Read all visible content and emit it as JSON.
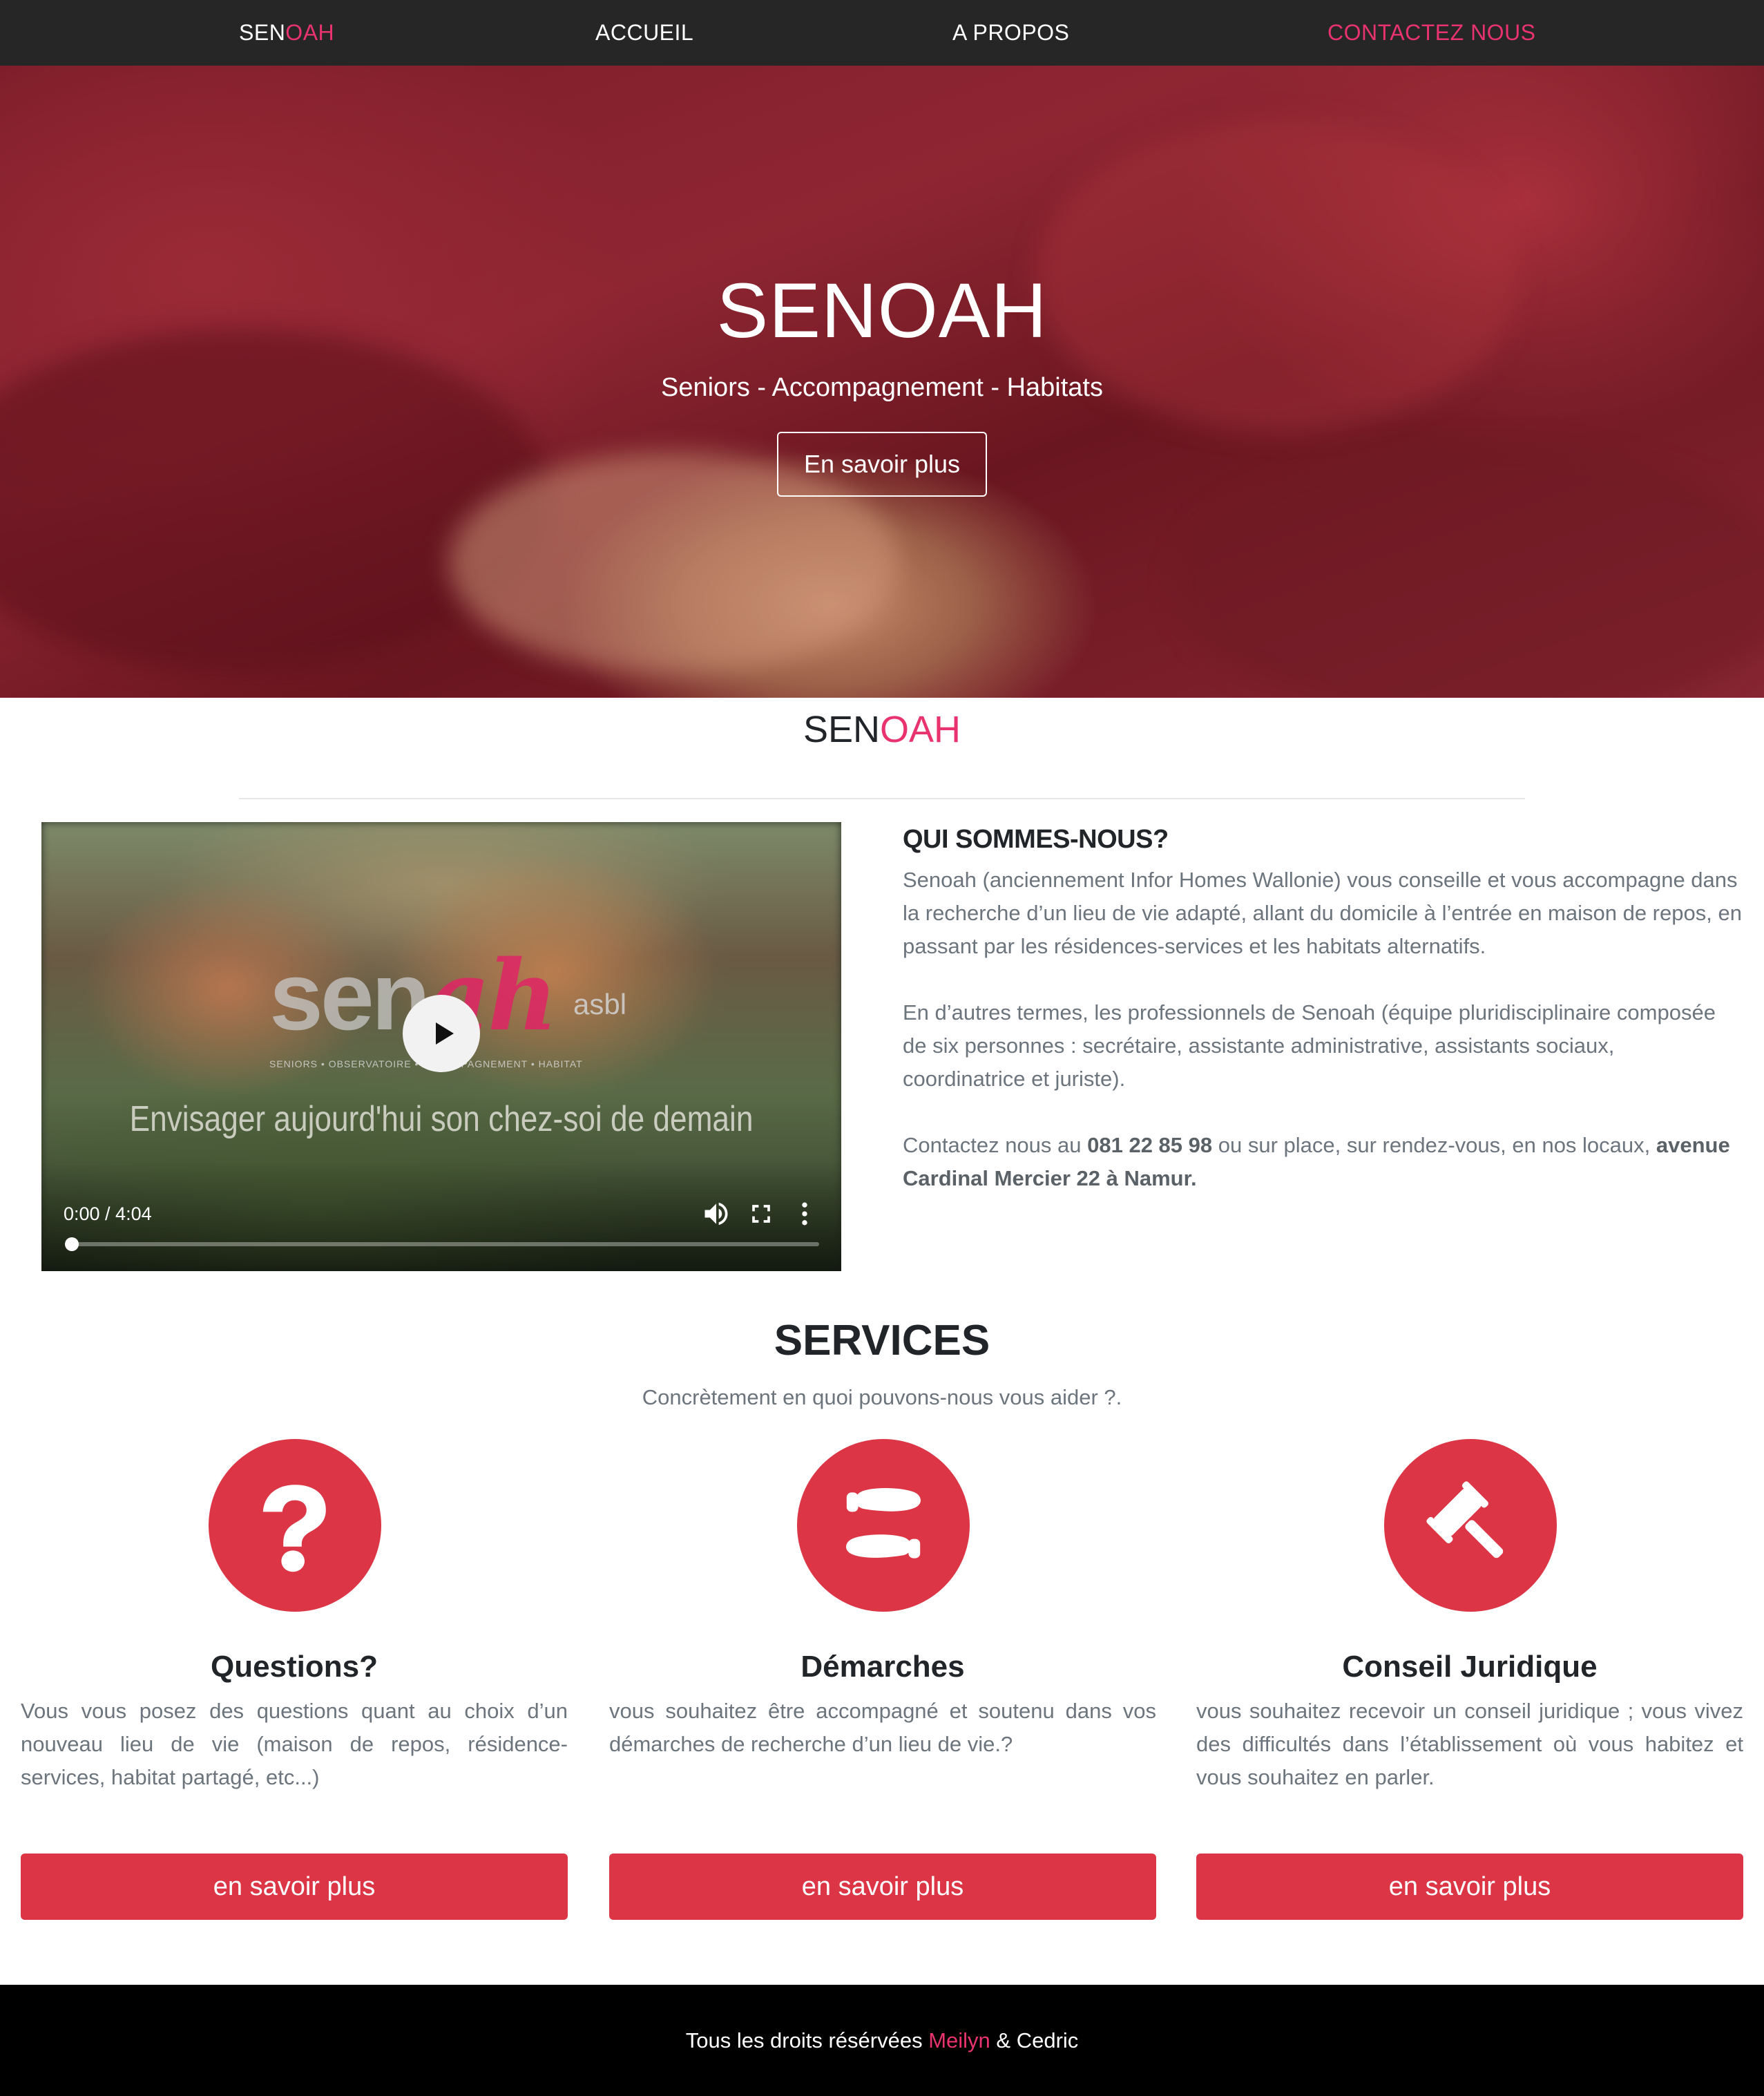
{
  "nav": {
    "brand_part1": "SEN",
    "brand_part2": "OAH",
    "items": [
      {
        "label": "ACCUEIL"
      },
      {
        "label": "A PROPOS"
      },
      {
        "label": "CONTACTEZ NOUS"
      }
    ]
  },
  "hero": {
    "title": "SENOAH",
    "subtitle": "Seniors - Accompagnement - Habitats",
    "button": "En savoir plus"
  },
  "section": {
    "brand_part1": "SEN",
    "brand_part2": "OAH"
  },
  "video": {
    "logo_part1": "sen",
    "logo_part2": "ah",
    "logo_suffix": "asbl",
    "logo_tagline": "SENIORS • OBSERVATOIRE • ACCOMPAGNEMENT • HABITAT",
    "caption": "Envisager aujourd'hui son chez-soi de demain",
    "time": "0:00 / 4:04",
    "progress": 0
  },
  "about": {
    "title": "QUI SOMMES-NOUS?",
    "p1": "Senoah (anciennement Infor Homes Wallonie) vous conseille et vous accompagne dans la recherche d’un lieu de vie adapté, allant du domicile à l’entrée en maison de repos, en passant par les résidences-services et les habitats alternatifs.",
    "p2": "En d’autres termes, les professionnels de Senoah (équipe pluridisciplinaire composée de six personnes : secrétaire, assistante administrative, assistants sociaux, coordinatrice et juriste).",
    "p3_a": "Contactez nous au ",
    "p3_phone": "081 22 85 98",
    "p3_b": " ou sur place, sur rendez-vous, en nos locaux, ",
    "p3_address": "avenue Cardinal Mercier 22 à Namur."
  },
  "services": {
    "title": "SERVICES",
    "subtitle": "Concrètement en quoi pouvons-nous vous aider ?.",
    "items": [
      {
        "icon": "question-icon",
        "title": "Questions?",
        "text": "Vous vous posez des questions quant au choix d’un nouveau lieu de vie (maison de repos, résidence-services, habitat partagé, etc...)",
        "button": "en savoir plus"
      },
      {
        "icon": "footprints-icon",
        "title": "Démarches",
        "text": "vous souhaitez être accompagné et soutenu dans vos démarches de recherche d’un lieu de vie.?",
        "button": "en savoir plus"
      },
      {
        "icon": "gavel-icon",
        "title": "Conseil Juridique",
        "text": "vous souhaitez recevoir un conseil juridique ; vous vivez des difficultés dans l’établissement où vous habitez et vous souhaitez en parler.",
        "button": "en savoir plus"
      }
    ]
  },
  "footer": {
    "text_a": "Tous les droits résérvées ",
    "name1": "Meilyn",
    "text_b": " & Cedric"
  },
  "colors": {
    "accent": "#e8336e",
    "button_red": "#dc3545",
    "nav_bg": "#262626",
    "footer_bg": "#000000"
  }
}
